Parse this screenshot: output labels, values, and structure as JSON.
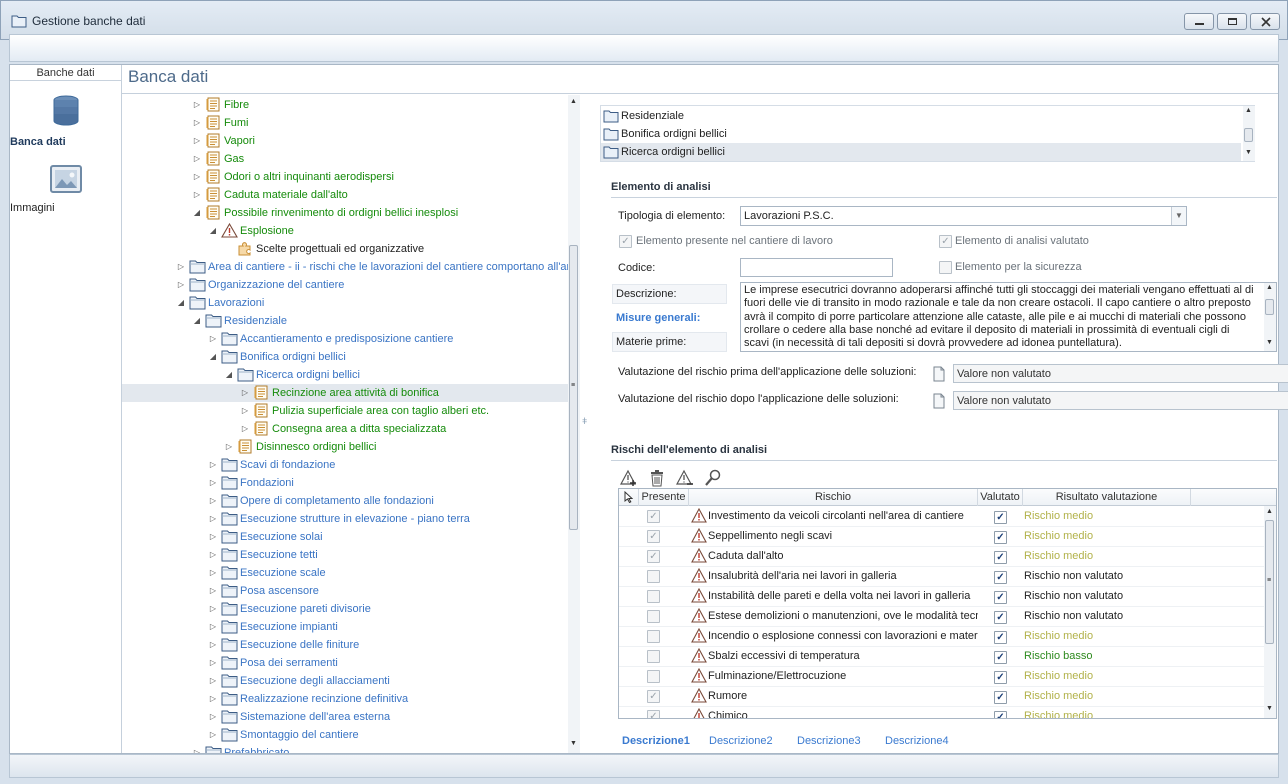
{
  "window": {
    "title": "Gestione banche dati"
  },
  "left_nav": {
    "header": "Banche dati",
    "items": [
      {
        "label": "Banca dati",
        "icon": "database-icon",
        "selected": true
      },
      {
        "label": "Immagini",
        "icon": "image-icon",
        "selected": false
      }
    ]
  },
  "header": {
    "title": "Banca dati"
  },
  "tree": {
    "items": [
      {
        "label": "Fibre",
        "level": 3,
        "icon": "document-icon",
        "color": "green",
        "expander": "collapsed"
      },
      {
        "label": "Fumi",
        "level": 3,
        "icon": "document-icon",
        "color": "green",
        "expander": "collapsed"
      },
      {
        "label": "Vapori",
        "level": 3,
        "icon": "document-icon",
        "color": "green",
        "expander": "collapsed"
      },
      {
        "label": "Gas",
        "level": 3,
        "icon": "document-icon",
        "color": "green",
        "expander": "collapsed"
      },
      {
        "label": "Odori o altri inquinanti aerodispersi",
        "level": 3,
        "icon": "document-icon",
        "color": "green",
        "expander": "collapsed"
      },
      {
        "label": "Caduta materiale dall'alto",
        "level": 3,
        "icon": "document-icon",
        "color": "green",
        "expander": "collapsed"
      },
      {
        "label": "Possibile rinvenimento di ordigni bellici inesplosi",
        "level": 3,
        "icon": "document-icon",
        "color": "green",
        "expander": "expanded"
      },
      {
        "label": "Esplosione",
        "level": 4,
        "icon": "warning-icon",
        "color": "green",
        "expander": "expanded"
      },
      {
        "label": "Scelte progettuali ed organizzative",
        "level": 5,
        "icon": "puzzle-icon",
        "color": "dark",
        "expander": "none"
      },
      {
        "label": "Area di cantiere - ii - rischi che le lavorazioni del cantiere comportano all'area circostante",
        "level": 2,
        "icon": "folder-icon",
        "color": "blue",
        "expander": "collapsed"
      },
      {
        "label": "Organizzazione del cantiere",
        "level": 2,
        "icon": "folder-icon",
        "color": "blue",
        "expander": "collapsed"
      },
      {
        "label": "Lavorazioni",
        "level": 2,
        "icon": "folder-icon",
        "color": "blue",
        "expander": "expanded"
      },
      {
        "label": "Residenziale",
        "level": 3,
        "icon": "folder-icon",
        "color": "blue",
        "expander": "expanded"
      },
      {
        "label": "Accantieramento e predisposizione cantiere",
        "level": 4,
        "icon": "folder-icon",
        "color": "blue",
        "expander": "collapsed"
      },
      {
        "label": "Bonifica ordigni bellici",
        "level": 4,
        "icon": "folder-icon",
        "color": "blue",
        "expander": "expanded"
      },
      {
        "label": "Ricerca ordigni bellici",
        "level": 5,
        "icon": "folder-icon",
        "color": "blue",
        "expander": "expanded"
      },
      {
        "label": "Recinzione area attività di bonifica",
        "level": 6,
        "icon": "document-icon",
        "color": "green",
        "expander": "collapsed",
        "selected": true
      },
      {
        "label": "Pulizia superficiale area con taglio alberi etc.",
        "level": 6,
        "icon": "document-icon",
        "color": "green",
        "expander": "collapsed"
      },
      {
        "label": "Consegna area a ditta specializzata",
        "level": 6,
        "icon": "document-icon",
        "color": "green",
        "expander": "collapsed"
      },
      {
        "label": "Disinnesco ordigni bellici",
        "level": 5,
        "icon": "document-icon",
        "color": "green",
        "expander": "collapsed"
      },
      {
        "label": "Scavi di fondazione",
        "level": 4,
        "icon": "folder-icon",
        "color": "blue",
        "expander": "collapsed"
      },
      {
        "label": "Fondazioni",
        "level": 4,
        "icon": "folder-icon",
        "color": "blue",
        "expander": "collapsed"
      },
      {
        "label": "Opere di completamento alle fondazioni",
        "level": 4,
        "icon": "folder-icon",
        "color": "blue",
        "expander": "collapsed"
      },
      {
        "label": "Esecuzione strutture in elevazione - piano terra",
        "level": 4,
        "icon": "folder-icon",
        "color": "blue",
        "expander": "collapsed"
      },
      {
        "label": "Esecuzione solai",
        "level": 4,
        "icon": "folder-icon",
        "color": "blue",
        "expander": "collapsed"
      },
      {
        "label": "Esecuzione tetti",
        "level": 4,
        "icon": "folder-icon",
        "color": "blue",
        "expander": "collapsed"
      },
      {
        "label": "Esecuzione scale",
        "level": 4,
        "icon": "folder-icon",
        "color": "blue",
        "expander": "collapsed"
      },
      {
        "label": "Posa ascensore",
        "level": 4,
        "icon": "folder-icon",
        "color": "blue",
        "expander": "collapsed"
      },
      {
        "label": "Esecuzione pareti divisorie",
        "level": 4,
        "icon": "folder-icon",
        "color": "blue",
        "expander": "collapsed"
      },
      {
        "label": "Esecuzione impianti",
        "level": 4,
        "icon": "folder-icon",
        "color": "blue",
        "expander": "collapsed"
      },
      {
        "label": "Esecuzione delle finiture",
        "level": 4,
        "icon": "folder-icon",
        "color": "blue",
        "expander": "collapsed"
      },
      {
        "label": "Posa dei serramenti",
        "level": 4,
        "icon": "folder-icon",
        "color": "blue",
        "expander": "collapsed"
      },
      {
        "label": "Esecuzione degli allacciamenti",
        "level": 4,
        "icon": "folder-icon",
        "color": "blue",
        "expander": "collapsed"
      },
      {
        "label": "Realizzazione recinzione definitiva",
        "level": 4,
        "icon": "folder-icon",
        "color": "blue",
        "expander": "collapsed"
      },
      {
        "label": "Sistemazione dell'area esterna",
        "level": 4,
        "icon": "folder-icon",
        "color": "blue",
        "expander": "collapsed"
      },
      {
        "label": "Smontaggio del cantiere",
        "level": 4,
        "icon": "folder-icon",
        "color": "blue",
        "expander": "collapsed"
      },
      {
        "label": "Prefabbricato",
        "level": 3,
        "icon": "folder-icon",
        "color": "blue",
        "expander": "collapsed"
      }
    ]
  },
  "location_list": {
    "items": [
      {
        "label": "Residenziale"
      },
      {
        "label": "Bonifica ordigni bellici"
      },
      {
        "label": "Ricerca ordigni bellici",
        "selected": true
      }
    ]
  },
  "elemento": {
    "section_title": "Elemento di analisi",
    "tipologia_label": "Tipologia di elemento:",
    "tipologia_value": "Lavorazioni P.S.C.",
    "presente_label": "Elemento presente nel cantiere di lavoro",
    "valutato_label": "Elemento di analisi valutato",
    "codice_label": "Codice:",
    "codice_value": "",
    "sicurezza_label": "Elemento per la sicurezza",
    "tabs": [
      {
        "label": "Descrizione:"
      },
      {
        "label": "Misure generali:",
        "active": true
      },
      {
        "label": "Materie prime:"
      }
    ],
    "description_text": "Le imprese esecutrici dovranno adoperarsi affinché tutti gli stoccaggi dei materiali vengano effettuati al di fuori delle vie di transito in modo razionale e tale da non creare ostacoli. Il capo cantiere o altro preposto avrà il compito di porre particolare attenzione alle cataste, alle pile e ai mucchi di materiali che possono crollare o cedere alla base nonché ad evitare il deposito di materiali in prossimità di eventuali cigli di scavi (in necessità di tali depositi si dovrà provvedere ad idonea puntellatura).",
    "val_prima_label": "Valutazione del rischio prima dell'applicazione delle soluzioni:",
    "val_prima_value": "Valore non valutato",
    "val_dopo_label": "Valutazione del rischio dopo l'applicazione delle soluzioni:",
    "val_dopo_value": "Valore non valutato"
  },
  "rischi": {
    "section_title": "Rischi dell'elemento di analisi",
    "columns": {
      "presente": "Presente",
      "rischio": "Rischio",
      "valutato": "Valutato",
      "risultato": "Risultato valutazione"
    },
    "rows": [
      {
        "presente": true,
        "rischio": "Investimento da veicoli circolanti nell'area di cantiere",
        "valutato": true,
        "risultato": "Rischio medio",
        "level": "medio"
      },
      {
        "presente": true,
        "rischio": "Seppellimento negli scavi",
        "valutato": true,
        "risultato": "Rischio medio",
        "level": "medio"
      },
      {
        "presente": true,
        "rischio": "Caduta dall'alto",
        "valutato": true,
        "risultato": "Rischio medio",
        "level": "medio"
      },
      {
        "presente": false,
        "rischio": "Insalubrità dell'aria nei lavori in galleria",
        "valutato": true,
        "risultato": "Rischio non valutato",
        "level": "nv"
      },
      {
        "presente": false,
        "rischio": "Instabilità delle pareti e della volta nei lavori in galleria",
        "valutato": true,
        "risultato": "Rischio non valutato",
        "level": "nv"
      },
      {
        "presente": false,
        "rischio": "Estese demolizioni o manutenzioni, ove le modalità tecniche",
        "valutato": true,
        "risultato": "Rischio non valutato",
        "level": "nv"
      },
      {
        "presente": false,
        "rischio": "Incendio o esplosione connessi con lavorazioni e materiali",
        "valutato": true,
        "risultato": "Rischio medio",
        "level": "medio"
      },
      {
        "presente": false,
        "rischio": "Sbalzi eccessivi di temperatura",
        "valutato": true,
        "risultato": "Rischio basso",
        "level": "basso"
      },
      {
        "presente": false,
        "rischio": "Fulminazione/Elettrocuzione",
        "valutato": true,
        "risultato": "Rischio medio",
        "level": "medio"
      },
      {
        "presente": true,
        "rischio": "Rumore",
        "valutato": true,
        "risultato": "Rischio medio",
        "level": "medio"
      },
      {
        "presente": true,
        "rischio": "Chimico",
        "valutato": true,
        "risultato": "Rischio medio",
        "level": "medio"
      }
    ]
  },
  "bottom_tabs": [
    {
      "label": "Descrizione1",
      "active": true
    },
    {
      "label": "Descrizione2"
    },
    {
      "label": "Descrizione3"
    },
    {
      "label": "Descrizione4"
    }
  ],
  "colors": {
    "green": "#158b0b",
    "blue": "#3a74c4",
    "medio": "#b2b24a",
    "basso": "#2e8a1e"
  }
}
